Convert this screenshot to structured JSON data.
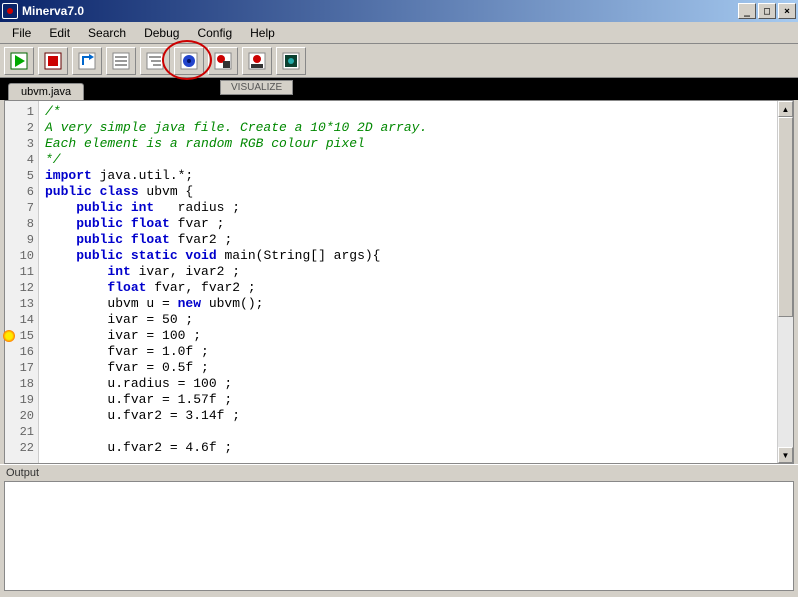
{
  "window": {
    "title": "Minerva7.0"
  },
  "menu": {
    "items": [
      "File",
      "Edit",
      "Search",
      "Debug",
      "Config",
      "Help"
    ]
  },
  "toolbar": {
    "buttons": [
      "run",
      "stop",
      "step-out",
      "step-over",
      "step-into",
      "visualize",
      "record",
      "record-alt",
      "screen"
    ],
    "annotation_index": 5
  },
  "visualize_button": "VISUALIZE",
  "tabs": {
    "items": [
      {
        "label": "ubvm.java"
      }
    ]
  },
  "editor": {
    "breakpoint_line": 15,
    "lines": [
      {
        "n": 1,
        "tokens": [
          {
            "t": "/*",
            "c": "cm"
          }
        ]
      },
      {
        "n": 2,
        "tokens": [
          {
            "t": "A very simple java file. Create a 10*10 2D array.",
            "c": "cm"
          }
        ]
      },
      {
        "n": 3,
        "tokens": [
          {
            "t": "Each element is a random RGB colour pixel",
            "c": "cm"
          }
        ]
      },
      {
        "n": 4,
        "tokens": [
          {
            "t": "*/",
            "c": "cm"
          }
        ]
      },
      {
        "n": 5,
        "tokens": [
          {
            "t": "import",
            "c": "kw"
          },
          {
            "t": " java.util.*;",
            "c": ""
          }
        ]
      },
      {
        "n": 6,
        "tokens": [
          {
            "t": "public class",
            "c": "kw"
          },
          {
            "t": " ubvm {",
            "c": ""
          }
        ]
      },
      {
        "n": 7,
        "tokens": [
          {
            "t": "    ",
            "c": ""
          },
          {
            "t": "public int",
            "c": "kw"
          },
          {
            "t": "   radius ;",
            "c": ""
          }
        ]
      },
      {
        "n": 8,
        "tokens": [
          {
            "t": "    ",
            "c": ""
          },
          {
            "t": "public float",
            "c": "kw"
          },
          {
            "t": " fvar ;",
            "c": ""
          }
        ]
      },
      {
        "n": 9,
        "tokens": [
          {
            "t": "    ",
            "c": ""
          },
          {
            "t": "public float",
            "c": "kw"
          },
          {
            "t": " fvar2 ;",
            "c": ""
          }
        ]
      },
      {
        "n": 10,
        "tokens": [
          {
            "t": "    ",
            "c": ""
          },
          {
            "t": "public static void",
            "c": "kw"
          },
          {
            "t": " main(String[] args){",
            "c": ""
          }
        ]
      },
      {
        "n": 11,
        "tokens": [
          {
            "t": "        ",
            "c": ""
          },
          {
            "t": "int",
            "c": "kw"
          },
          {
            "t": " ivar, ivar2 ;",
            "c": ""
          }
        ]
      },
      {
        "n": 12,
        "tokens": [
          {
            "t": "        ",
            "c": ""
          },
          {
            "t": "float",
            "c": "kw"
          },
          {
            "t": " fvar, fvar2 ;",
            "c": ""
          }
        ]
      },
      {
        "n": 13,
        "tokens": [
          {
            "t": "        ubvm u = ",
            "c": ""
          },
          {
            "t": "new",
            "c": "kw"
          },
          {
            "t": " ubvm();",
            "c": ""
          }
        ]
      },
      {
        "n": 14,
        "tokens": [
          {
            "t": "        ivar = 50 ;",
            "c": ""
          }
        ]
      },
      {
        "n": 15,
        "tokens": [
          {
            "t": "        ivar = 100 ;",
            "c": ""
          }
        ]
      },
      {
        "n": 16,
        "tokens": [
          {
            "t": "        fvar = 1.0f ;",
            "c": ""
          }
        ]
      },
      {
        "n": 17,
        "tokens": [
          {
            "t": "        fvar = 0.5f ;",
            "c": ""
          }
        ]
      },
      {
        "n": 18,
        "tokens": [
          {
            "t": "        u.radius = 100 ;",
            "c": ""
          }
        ]
      },
      {
        "n": 19,
        "tokens": [
          {
            "t": "        u.fvar = 1.57f ;",
            "c": ""
          }
        ]
      },
      {
        "n": 20,
        "tokens": [
          {
            "t": "        u.fvar2 = 3.14f ;",
            "c": ""
          }
        ]
      },
      {
        "n": 21,
        "tokens": [
          {
            "t": "",
            "c": ""
          }
        ]
      },
      {
        "n": 22,
        "tokens": [
          {
            "t": "        u.fvar2 = 4.6f ;",
            "c": ""
          }
        ]
      }
    ]
  },
  "output": {
    "label": "Output",
    "content": ""
  }
}
